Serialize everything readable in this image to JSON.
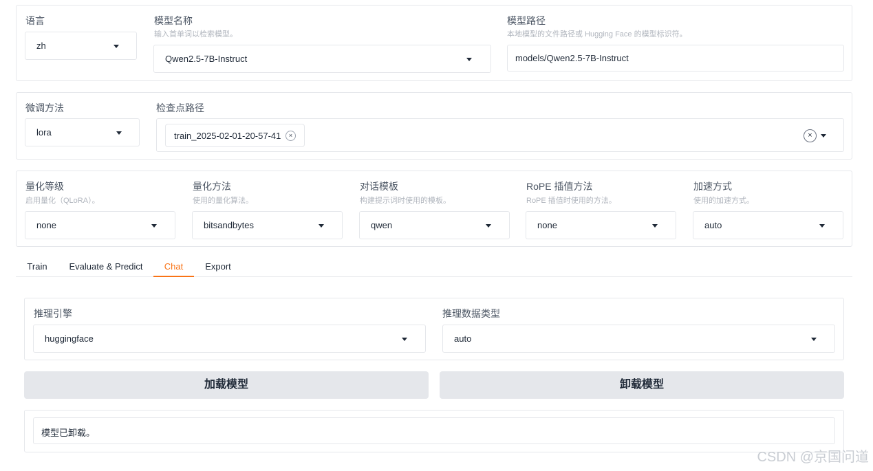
{
  "top": {
    "lang": {
      "label": "语言",
      "value": "zh"
    },
    "model_name": {
      "label": "模型名称",
      "info": "输入首单词以检索模型。",
      "value": "Qwen2.5-7B-Instruct"
    },
    "model_path": {
      "label": "模型路径",
      "info": "本地模型的文件路径或 Hugging Face 的模型标识符。",
      "value": "models/Qwen2.5-7B-Instruct"
    }
  },
  "finetune": {
    "method": {
      "label": "微调方法",
      "value": "lora"
    },
    "checkpoint": {
      "label": "检查点路径",
      "tokens": [
        "train_2025-02-01-20-57-41"
      ],
      "remove_token": "×",
      "clear": "×"
    }
  },
  "advanced": {
    "quant_bit": {
      "label": "量化等级",
      "info": "启用量化（QLoRA）。",
      "value": "none"
    },
    "quant_method": {
      "label": "量化方法",
      "info": "使用的量化算法。",
      "value": "bitsandbytes"
    },
    "template": {
      "label": "对话模板",
      "info": "构建提示词时使用的模板。",
      "value": "qwen"
    },
    "rope": {
      "label": "RoPE 插值方法",
      "info": "RoPE 插值时使用的方法。",
      "value": "none"
    },
    "booster": {
      "label": "加速方式",
      "info": "使用的加速方式。",
      "value": "auto"
    }
  },
  "tabs": [
    {
      "label": "Train",
      "active": false
    },
    {
      "label": "Evaluate & Predict",
      "active": false
    },
    {
      "label": "Chat",
      "active": true
    },
    {
      "label": "Export",
      "active": false
    }
  ],
  "chat": {
    "infer_backend": {
      "label": "推理引擎",
      "value": "huggingface"
    },
    "infer_dtype": {
      "label": "推理数据类型",
      "value": "auto"
    },
    "load_button": "加载模型",
    "unload_button": "卸载模型",
    "status": "模型已卸载。"
  },
  "watermark": "CSDN @京国问道",
  "icons": {
    "dropdown": "caret-down-icon",
    "remove": "close-icon"
  }
}
